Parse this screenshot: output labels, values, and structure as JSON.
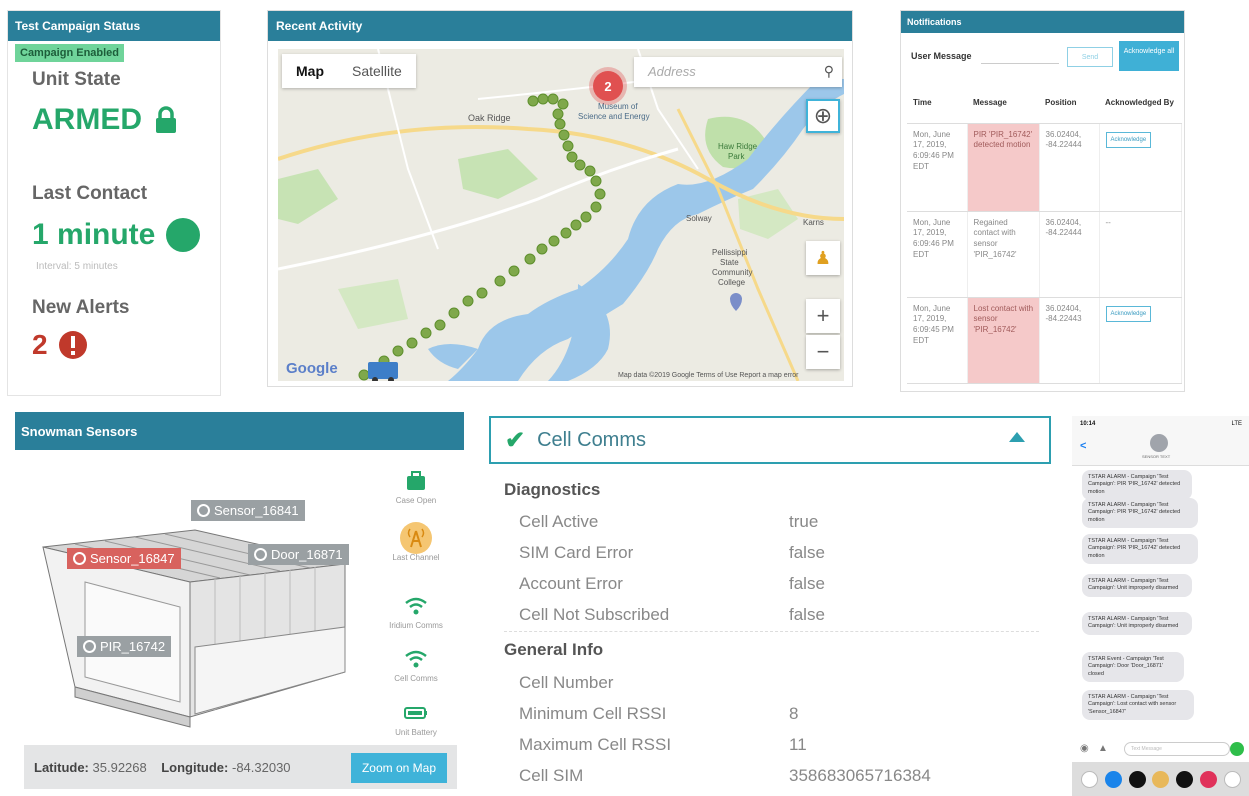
{
  "campaign": {
    "title": "Test Campaign Status",
    "badge": "Campaign Enabled",
    "unit_state_label": "Unit State",
    "unit_state": "ARMED",
    "last_contact_label": "Last Contact",
    "last_contact": "1 minute",
    "interval": "Interval: 5 minutes",
    "new_alerts_label": "New Alerts",
    "new_alerts": "2"
  },
  "activity": {
    "title": "Recent Activity",
    "map_tab": "Map",
    "satellite_tab": "Satellite",
    "address_placeholder": "Address",
    "cluster_count": "2",
    "labels": {
      "oak_ridge": "Oak Ridge",
      "museum": "Museum of Science and Energy",
      "haw_ridge": "Haw Ridge Park",
      "solway": "Solway",
      "karns": "Karns",
      "pellissippi": "Pellissippi State Community College"
    },
    "google": "Google",
    "footer": "Map data ©2019 Google   Terms of Use   Report a map error"
  },
  "notifications": {
    "title": "Notifications",
    "user_message_label": "User Message",
    "send_label": "Send",
    "ack_all_label": "Acknowledge all",
    "columns": [
      "Time",
      "Message",
      "Position",
      "Acknowledged By"
    ],
    "rows": [
      {
        "time": "Mon, June 17, 2019, 6:09:46 PM EDT",
        "message": "PIR 'PIR_16742' detected motion",
        "position": "36.02404, -84.22444",
        "ack": "Acknowledge",
        "alert": true
      },
      {
        "time": "Mon, June 17, 2019, 6:09:46 PM EDT",
        "message": "Regained contact with sensor 'PIR_16742'",
        "position": "36.02404, -84.22444",
        "ack": "--",
        "alert": false
      },
      {
        "time": "Mon, June 17, 2019, 6:09:45 PM EDT",
        "message": "Lost contact with sensor 'PIR_16742'",
        "position": "36.02404, -84.22443",
        "ack": "Acknowledge",
        "alert": true
      }
    ]
  },
  "sensors": {
    "title": "Snowman Sensors",
    "tags": [
      "Sensor_16841",
      "Sensor_16847",
      "Door_16871",
      "PIR_16742"
    ],
    "side": [
      "Case Open",
      "Last Channel",
      "Iridium Comms",
      "Cell Comms",
      "Unit Battery"
    ],
    "lat_label": "Latitude:",
    "lat": "35.92268",
    "lon_label": "Longitude:",
    "lon": "-84.32030",
    "zoom_label": "Zoom on Map"
  },
  "cell": {
    "title": "Cell Comms",
    "diag_label": "Diagnostics",
    "diag": [
      {
        "k": "Cell Active",
        "v": "true"
      },
      {
        "k": "SIM Card Error",
        "v": "false"
      },
      {
        "k": "Account Error",
        "v": "false"
      },
      {
        "k": "Cell Not Subscribed",
        "v": "false"
      }
    ],
    "info_label": "General Info",
    "info": [
      {
        "k": "Cell Number",
        "v": ""
      },
      {
        "k": "Minimum Cell RSSI",
        "v": "8"
      },
      {
        "k": "Maximum Cell RSSI",
        "v": "11"
      },
      {
        "k": "Cell SIM",
        "v": "358683065716384"
      }
    ]
  },
  "phone": {
    "time": "10:14",
    "battery": "LTE",
    "back": "<",
    "contact": "SENSOR TEXT",
    "messages": [
      "TSTAR ALARM - Campaign 'Test Campaign': PIR 'PIR_16742' detected motion",
      "TSTAR ALARM - Campaign 'Test Campaign': PIR 'PIR_16742' detected motion",
      "TSTAR ALARM - Campaign 'Test Campaign': PIR 'PIR_16742' detected motion",
      "TSTAR ALARM - Campaign 'Test Campaign': Unit improperly disarmed",
      "TSTAR ALARM - Campaign 'Test Campaign': Unit improperly disarmed",
      "TSTAR Event - Campaign 'Test Campaign': Door 'Door_16871' closed",
      "TSTAR ALARM - Campaign 'Test Campaign': Lost contact with sensor 'Sensor_16847'"
    ],
    "input_placeholder": "Text Message"
  },
  "colors": {
    "header": "#2a7f9a",
    "green": "#25a76a",
    "red": "#c0392b",
    "accent": "#3fb3d9"
  }
}
